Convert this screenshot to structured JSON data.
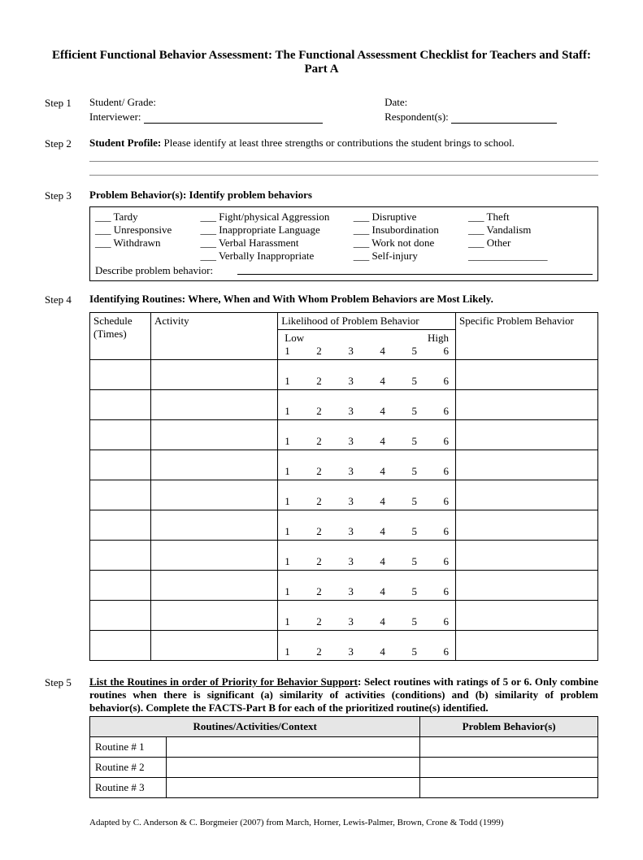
{
  "title": "Efficient Functional Behavior Assessment: The Functional Assessment Checklist for Teachers and Staff: Part A",
  "step1": {
    "label": "Step 1",
    "student_grade_label": "Student/ Grade:",
    "date_label": "Date:",
    "interviewer_label": "Interviewer:",
    "respondent_label": "Respondent(s):"
  },
  "step2": {
    "label": "Step 2",
    "profile_bold": "Student Profile:",
    "profile_text": " Please identify at least three strengths or contributions the student brings to school."
  },
  "step3": {
    "label": "Step 3",
    "heading_bold": "Problem Behavior(s)",
    "heading_rest": ":  Identify problem behaviors",
    "col1": [
      "Tardy",
      "Unresponsive",
      "Withdrawn"
    ],
    "col2": [
      "Fight/physical Aggression",
      "Inappropriate Language",
      "Verbal Harassment",
      "Verbally Inappropriate"
    ],
    "col3": [
      "Disruptive",
      "Insubordination",
      "Work not done",
      "Self-injury"
    ],
    "col4": [
      "Theft",
      "Vandalism",
      "Other _______________"
    ],
    "describe_label": "Describe problem behavior:"
  },
  "step4": {
    "label": "Step 4",
    "heading": "Identifying Routines: Where, When and With Whom Problem Behaviors are Most Likely.",
    "headers": {
      "schedule": "Schedule (Times)",
      "activity": "Activity",
      "likelihood": "Likelihood of Problem Behavior",
      "specific": "Specific Problem Behavior",
      "low": "Low",
      "high": "High"
    },
    "scale": [
      "1",
      "2",
      "3",
      "4",
      "5",
      "6"
    ],
    "rows": 11
  },
  "step5": {
    "label": "Step 5",
    "heading_bold": "List the Routines in order of Priority for Behavior Support",
    "heading_rest": ": Select routines with ratings of 5 or 6.  Only combine routines when there is significant (a) similarity of activities (conditions) and (b) similarity of problem behavior(s).  Complete the FACTS-Part B for each of the prioritized routine(s) identified.",
    "th1": "Routines/Activities/Context",
    "th2": "Problem Behavior(s)",
    "rows": [
      "Routine # 1",
      "Routine # 2",
      "Routine # 3"
    ]
  },
  "footer": "Adapted by C. Anderson & C. Borgmeier (2007) from March, Horner, Lewis-Palmer, Brown, Crone & Todd (1999)"
}
